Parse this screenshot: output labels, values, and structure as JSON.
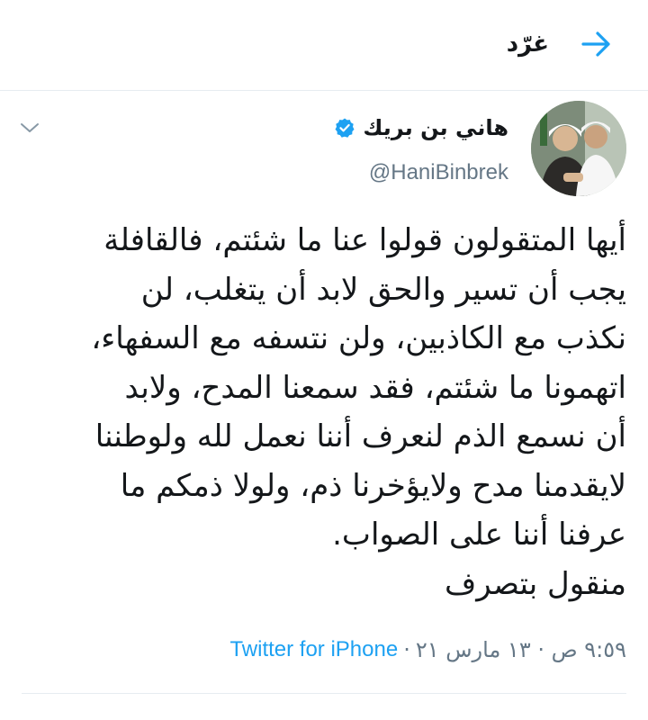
{
  "header": {
    "title": "غرّد",
    "back_icon": "arrow-right-icon",
    "accent_color": "#1da1f2"
  },
  "tweet": {
    "author": {
      "display_name": "هاني بن بريك",
      "handle": "@HaniBinbrek",
      "verified_icon": "verified-badge-icon"
    },
    "menu_icon": "chevron-down-icon",
    "text_lines": [
      "أيها المتقولون قولوا عنا ما شئتم، فالقافلة",
      "يجب أن تسير والحق لابد أن يتغلب، لن",
      "نكذب مع الكاذبين، ولن نتسفه مع السفهاء،",
      "اتهمونا ما شئتم، فقد سمعنا المدح، ولابد",
      "أن نسمع الذم لنعرف أننا نعمل لله ولوطننا",
      "لايقدمنا مدح ولايؤخرنا ذم، ولولا ذمكم ما",
      "عرفنا أننا على الصواب.",
      "منقول بتصرف"
    ],
    "timestamp": "٩:٥٩ ص · ١٣ مارس ٢١",
    "separator": "·",
    "source": "Twitter for iPhone"
  }
}
